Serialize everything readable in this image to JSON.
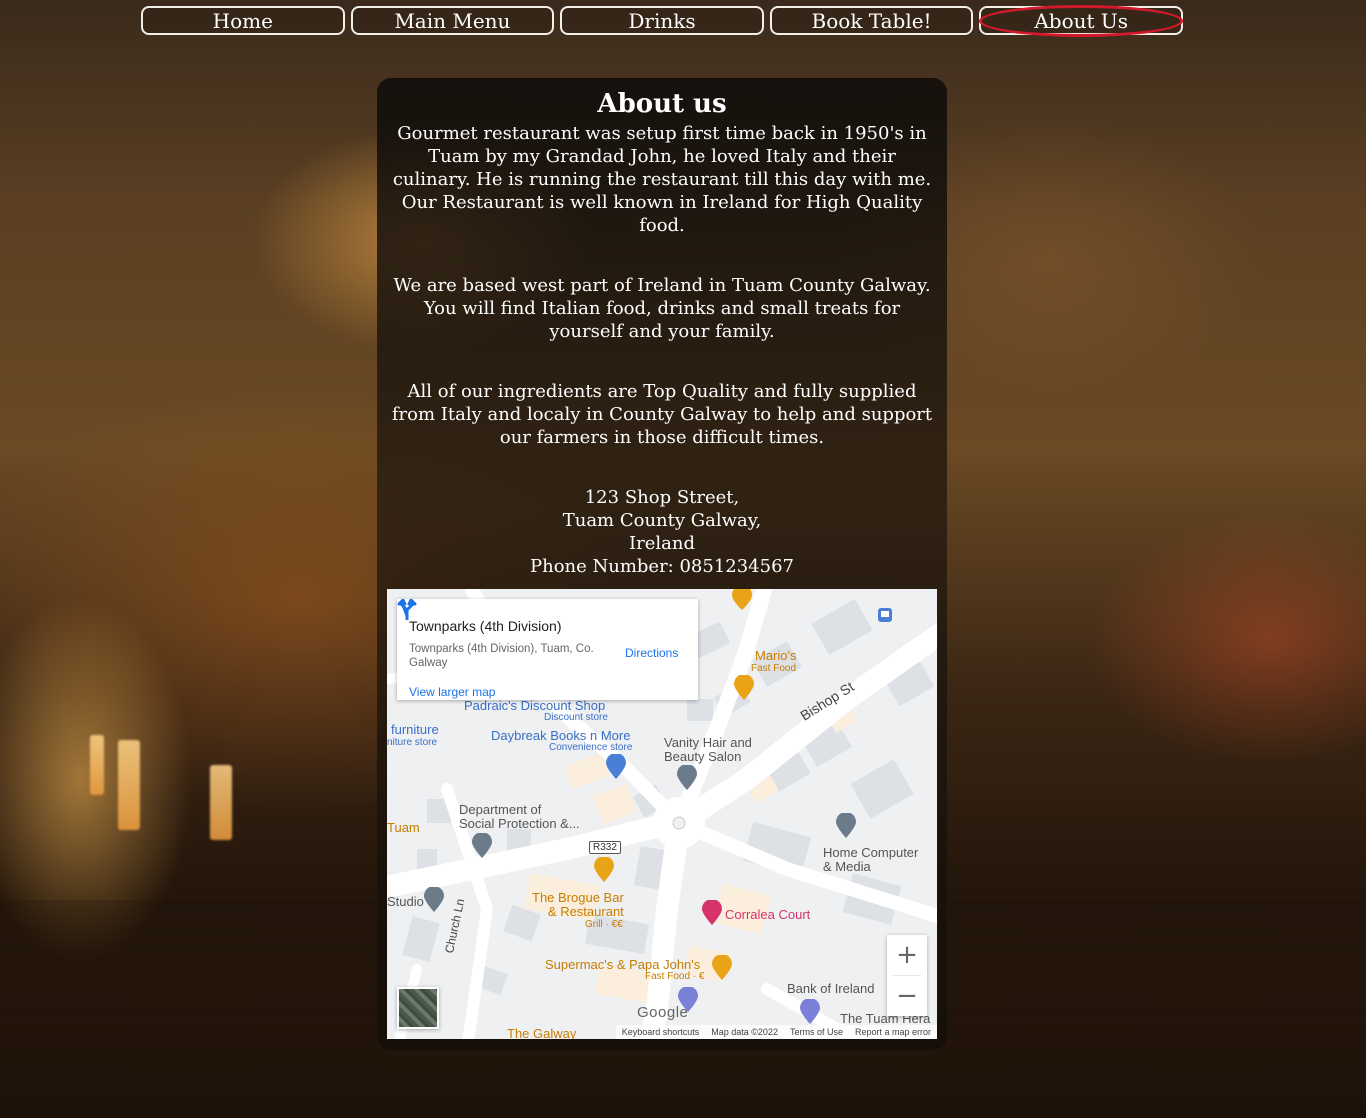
{
  "nav": {
    "items": [
      "Home",
      "Main Menu",
      "Drinks",
      "Book Table!",
      "About Us"
    ],
    "active": "About Us"
  },
  "about": {
    "title": "About us",
    "paragraphs": [
      "Gourmet restaurant was setup first time back in 1950's in Tuam by my Grandad John, he loved Italy and their culinary. He is running the restaurant till this day with me. Our Restaurant is well known in Ireland for High Quality food.",
      "We are based west part of Ireland in Tuam County Galway. You will find Italian food, drinks and small treats for yourself and your family.",
      "All of our ingredients are Top Quality and fully supplied from Italy and localy in County Galway to help and support our farmers in those difficult times."
    ],
    "address_line1": "123 Shop Street,",
    "address_line2": "Tuam County Galway,",
    "address_line3": "Ireland",
    "phone": "Phone Number: 0851234567"
  },
  "map": {
    "info_title": "Townparks (4th Division)",
    "info_address": "Townparks (4th Division), Tuam, Co. Galway",
    "view_larger": "View larger map",
    "directions": "Directions",
    "zoom_in": "+",
    "zoom_out": "−",
    "google": "Google",
    "attribution": [
      "Keyboard shortcuts",
      "Map data ©2022",
      "Terms of Use",
      "Report a map error"
    ],
    "places": {
      "marios": "Mario's",
      "marios_sub": "Fast Food",
      "padraics": "Padraic's Discount Shop",
      "padraics_sub": "Discount store",
      "daybreak": "Daybreak Books n More",
      "daybreak_sub": "Convenience store",
      "vanity": "Vanity Hair and Beauty Salon",
      "department": "Department of Social Protection &...",
      "home_computer": "Home Computer & Media",
      "brogue": "The Brogue Bar & Restaurant",
      "brogue_sub": "Grill · €€",
      "corralea": "Corralea Court",
      "supermacs": "Supermac's & Papa John's",
      "supermacs_sub": "Fast Food · €",
      "bank": "Bank of Ireland",
      "tuam_herald": "The Tuam Hera",
      "galway": "The Galway",
      "furniture": "furniture",
      "furniture_sub": "niture store",
      "tuam": "Tuam",
      "studio": "Studio",
      "bishop_st": "Bishop St",
      "church_ln": "Church Ln",
      "r332": "R332"
    }
  },
  "colors": {
    "active_ring": "#d0192a",
    "nav_border": "#f2efe8",
    "map_link": "#1a73e8",
    "food_pin": "#e8a317",
    "place_pin": "#6b7b8a",
    "pink_pin": "#d6336c"
  }
}
